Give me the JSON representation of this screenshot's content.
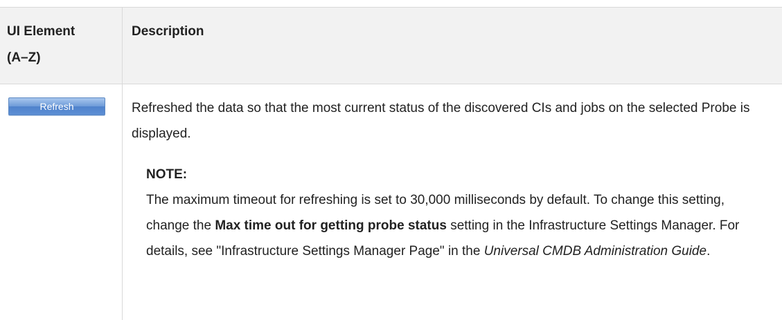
{
  "table": {
    "header": {
      "element_col_line1": "UI Element",
      "element_col_line2": "(A–Z)",
      "description_col": "Description"
    },
    "row": {
      "button_label": "Refresh",
      "description": "Refreshed the data so that the most current status of the discovered CIs and jobs on the selected Probe is displayed.",
      "note": {
        "label": "NOTE:",
        "text_1": "The maximum timeout for refreshing is set to 30,000 milliseconds by default. To change this setting, change the ",
        "bold_setting": "Max time out for getting probe status",
        "text_2": " setting in the Infrastructure Settings Manager. For details, see \"Infrastructure Settings Manager Page\" in the ",
        "guide_title": "Universal CMDB Administration Guide",
        "text_3": "."
      }
    }
  }
}
